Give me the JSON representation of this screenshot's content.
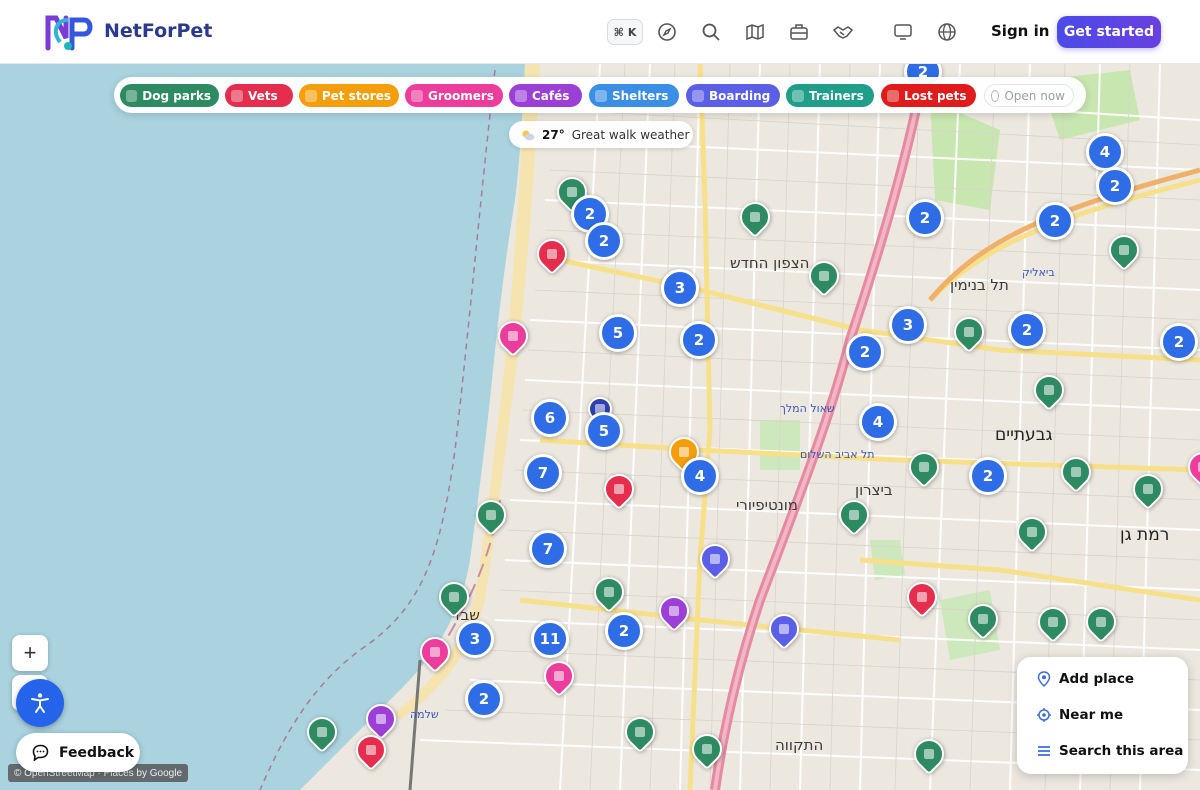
{
  "header": {
    "brand": "NetForPet",
    "shortcut_cmd": "⌘",
    "shortcut_key": "K",
    "sign_in": "Sign in",
    "get_started": "Get started",
    "nav_icons": [
      "compass-icon",
      "search-icon",
      "map-icon",
      "briefcase-icon",
      "handshake-icon",
      "monitor-icon",
      "globe-icon"
    ]
  },
  "filters": [
    {
      "label": "Dog parks",
      "color": "#2e8b61",
      "icon": "paw-icon"
    },
    {
      "label": "Vets",
      "color": "#e52e4d",
      "icon": "vet-icon"
    },
    {
      "label": "Pet stores",
      "color": "#f59e0b",
      "icon": "store-icon"
    },
    {
      "label": "Groomers",
      "color": "#ec3c9c",
      "icon": "scissors-icon"
    },
    {
      "label": "Cafés",
      "color": "#9b3fd6",
      "icon": "cafe-icon"
    },
    {
      "label": "Shelters",
      "color": "#3a8ee6",
      "icon": "house-icon"
    },
    {
      "label": "Boarding",
      "color": "#5b5fe8",
      "icon": "hotel-icon"
    },
    {
      "label": "Trainers",
      "color": "#1f9e8a",
      "icon": "cap-icon"
    },
    {
      "label": "Lost pets",
      "color": "#e01b1b",
      "icon": "alert-icon"
    },
    {
      "label": "Open now",
      "color": "#ffffff",
      "icon": "clock-icon"
    }
  ],
  "weather": {
    "temp": "27°",
    "text": "Great walk weather"
  },
  "clusters": [
    "2",
    "4",
    "2",
    "2",
    "2",
    "2",
    "2",
    "3",
    "5",
    "2",
    "3",
    "2",
    "2",
    "6",
    "5",
    "4",
    "7",
    "4",
    "2",
    "7",
    "2",
    "3",
    "11",
    "2",
    "2"
  ],
  "map_labels": {
    "a": "הצפון החדש",
    "b": "תל בנימין",
    "c": "גבעתיים",
    "d": "מונטיפיורי",
    "e": "תל אביב השלום",
    "f": "שבזי",
    "g": "שלמה",
    "h": "התקווה",
    "i": "רמת גן",
    "j": "ביצרון",
    "k": "שאול המלך",
    "l": "ביאליק"
  },
  "controls": {
    "zoom_in": "+",
    "feedback": "Feedback",
    "attribution": "© OpenStreetMap · Places by Google",
    "add_place": "Add place",
    "near_me": "Near me",
    "search_area": "Search this area"
  }
}
